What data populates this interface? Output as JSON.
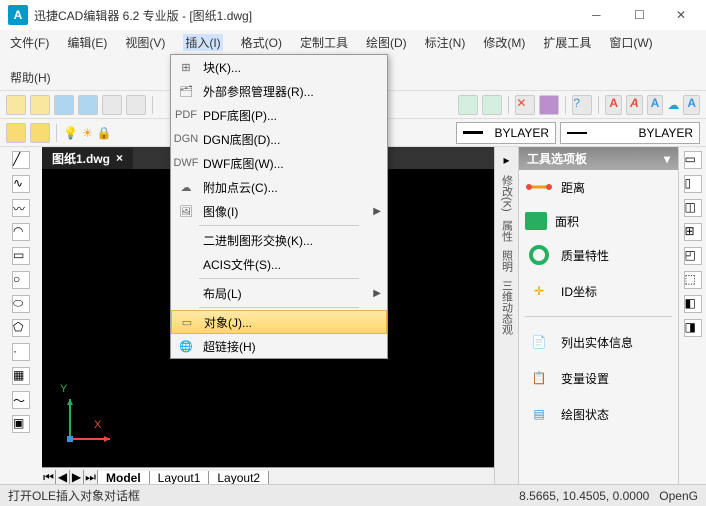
{
  "title": {
    "app": "迅捷CAD编辑器 6.2 专业版",
    "doc": " - [图纸1.dwg]"
  },
  "menubar": [
    "文件(F)",
    "编辑(E)",
    "视图(V)",
    "插入(I)",
    "格式(O)",
    "定制工具",
    "绘图(D)",
    "标注(N)",
    "修改(M)",
    "扩展工具",
    "窗口(W)",
    "帮助(H)"
  ],
  "layerprops": {
    "bylayer1": "BYLAYER",
    "bylayer2": "BYLAYER"
  },
  "doc_tab": "图纸1.dwg",
  "layout_tabs": [
    "Model",
    "Layout1",
    "Layout2"
  ],
  "dropdown": [
    {
      "label": "块(K)...",
      "arrow": false
    },
    {
      "label": "外部参照管理器(R)...",
      "arrow": false
    },
    {
      "label": "PDF底图(P)...",
      "arrow": false
    },
    {
      "label": "DGN底图(D)...",
      "arrow": false
    },
    {
      "label": "DWF底图(W)...",
      "arrow": false
    },
    {
      "label": "附加点云(C)...",
      "arrow": false
    },
    {
      "label": "图像(I)",
      "arrow": true,
      "sep_after": true
    },
    {
      "label": "二进制图形交换(K)...",
      "arrow": false
    },
    {
      "label": "ACIS文件(S)...",
      "arrow": false,
      "sep_after": true
    },
    {
      "label": "布局(L)",
      "arrow": true,
      "sep_after": true
    },
    {
      "label": "对象(J)...",
      "arrow": false,
      "hover": true
    },
    {
      "label": "超链接(H)",
      "arrow": false
    }
  ],
  "palette": {
    "title": "工具选项板",
    "items": [
      "距离",
      "面积",
      "质量特性",
      "ID坐标",
      "列出实体信息",
      "变量设置",
      "绘图状态"
    ]
  },
  "side_labels": [
    "修改(K)",
    "属性",
    "照明",
    "三维动态观"
  ],
  "status": {
    "left": "打开OLE插入对象对话框",
    "coords": "8.5665, 10.4505, 0.0000",
    "mode": "OpenG"
  },
  "axis": {
    "x": "X",
    "y": "Y"
  }
}
